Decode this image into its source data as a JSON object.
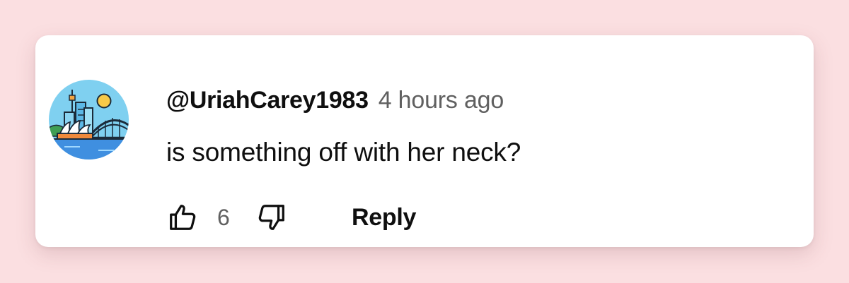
{
  "comment": {
    "author": "@UriahCarey1983",
    "timestamp": "4 hours ago",
    "text": "is something off with her neck?",
    "likes": "6",
    "reply_label": "Reply"
  },
  "icons": {
    "avatar": "city-harbor-avatar",
    "like": "thumbs-up-icon",
    "dislike": "thumbs-down-icon"
  },
  "colors": {
    "page_background": "#fbdfe1",
    "card_background": "#ffffff",
    "primary_text": "#0f0f0f",
    "secondary_text": "#606060"
  }
}
